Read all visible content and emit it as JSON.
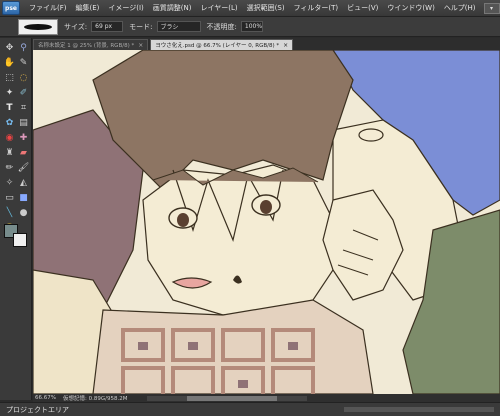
{
  "app": {
    "logo_text": "pse"
  },
  "menu": {
    "items": [
      {
        "label": "ファイル(F)"
      },
      {
        "label": "編集(E)"
      },
      {
        "label": "イメージ(I)"
      },
      {
        "label": "画質調整(N)"
      },
      {
        "label": "レイヤー(L)"
      },
      {
        "label": "選択範囲(S)"
      },
      {
        "label": "フィルター(T)"
      },
      {
        "label": "ビュー(V)"
      },
      {
        "label": "ウインドウ(W)"
      },
      {
        "label": "ヘルプ(H)"
      }
    ]
  },
  "options": {
    "size_label": "サイズ:",
    "size_value": "69 px",
    "mode_label": "モード:",
    "mode_value": "ブラシ",
    "opacity_label": "不透明度:",
    "opacity_value": "100%"
  },
  "tabs": [
    {
      "label": "名称未設定 1 @ 25% (背景, RGB/8) *"
    },
    {
      "label": "ヨウさ化え.psd @ 66.7% (レイヤー 0, RGB/8) *"
    }
  ],
  "tab_close": "×",
  "status": {
    "zoom": "66.67%",
    "doc_info": "仮想記憶: 0.89G/958.2M"
  },
  "project_bin": {
    "label": "プロジェクトエリア"
  },
  "colors": {
    "foreground": "#778c8c",
    "background": "#f0f0f0",
    "canvas_bg": "#f1ead6"
  },
  "tools": [
    "move-icon",
    "zoom-icon",
    "hand-icon",
    "eyedropper-icon",
    "marquee-icon",
    "lasso-icon",
    "magic-wand-icon",
    "quick-select-icon",
    "type-icon",
    "crop-icon",
    "cookie-cutter-icon",
    "straighten-icon",
    "red-eye-icon",
    "healing-icon",
    "clone-stamp-icon",
    "eraser-icon",
    "pencil-icon",
    "brush-icon",
    "smart-brush-icon",
    "paint-bucket-icon",
    "gradient-icon",
    "shape-icon",
    "blur-icon",
    "sponge-icon"
  ]
}
